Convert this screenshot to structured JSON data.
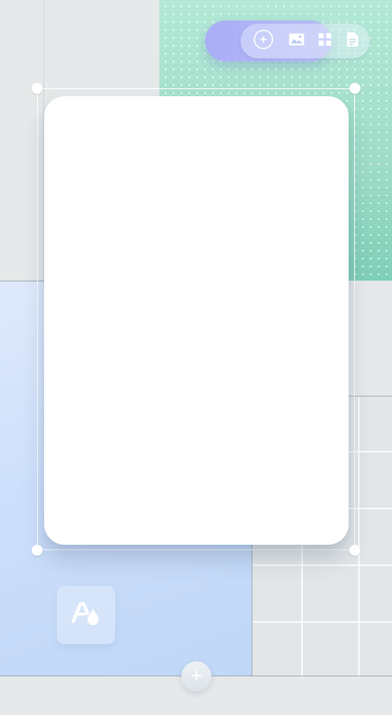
{
  "toolbar": {
    "items": [
      {
        "icon": "add-circle-icon"
      },
      {
        "icon": "image-icon"
      },
      {
        "icon": "grid-icon"
      },
      {
        "icon": "document-icon"
      }
    ]
  },
  "theme_tile": {
    "icon": "font-color-icon"
  },
  "bottom_button": {
    "icon": "plus-icon"
  },
  "colors": {
    "background": "#e6e9ea",
    "teal_panel": "#a6e2cf",
    "blue_panel": "#cddffb",
    "toolbar_accent": "#a9aef6",
    "card": "#ffffff"
  }
}
